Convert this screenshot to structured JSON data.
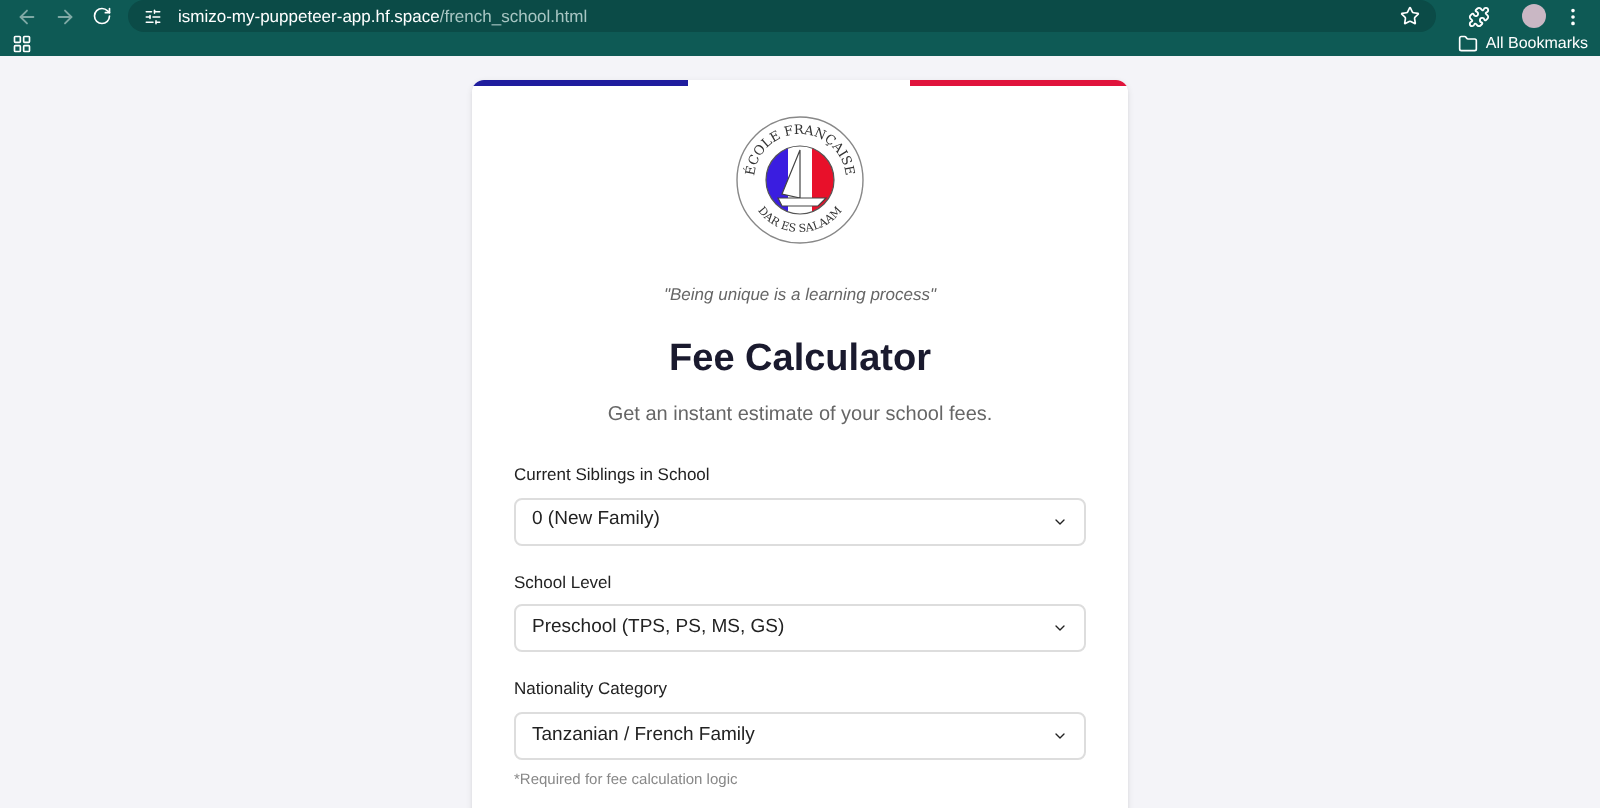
{
  "browser": {
    "url_host": "ismizo-my-puppeteer-app.hf.space",
    "url_path": "/french_school.html",
    "bookmarks_label": "All Bookmarks"
  },
  "logo": {
    "top_text": "ÉCOLE FRANÇAISE",
    "bottom_text": "DAR ES SALAAM"
  },
  "quote": "\"Being unique is a learning process\"",
  "title": "Fee Calculator",
  "subtitle": "Get an instant estimate of your school fees.",
  "fields": [
    {
      "label": "Current Siblings in School",
      "value": "0 (New Family)"
    },
    {
      "label": "School Level",
      "value": "Preschool (TPS, PS, MS, GS)"
    },
    {
      "label": "Nationality Category",
      "value": "Tanzanian / French Family",
      "note": "*Required for fee calculation logic"
    }
  ]
}
